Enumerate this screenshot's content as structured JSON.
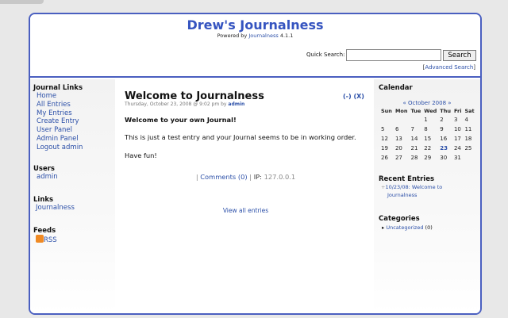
{
  "header": {
    "title": "Drew's Journalness",
    "powered_prefix": "Powered by",
    "powered_link": "Journalness",
    "version": "4.1.1",
    "search_label": "Quick Search:",
    "search_value": "",
    "search_button": "Search",
    "advanced_search": "Advanced Search"
  },
  "left": {
    "journal_links_title": "Journal Links",
    "journal_links": [
      "Home",
      "All Entries",
      "My Entries",
      "Create Entry",
      "User Panel",
      "Admin Panel",
      "Logout admin"
    ],
    "users_title": "Users",
    "users": [
      "admin"
    ],
    "links_title": "Links",
    "links": [
      "Journalness"
    ],
    "feeds_title": "Feeds",
    "feeds": [
      "RSS"
    ]
  },
  "entry": {
    "title": "Welcome to Journalness",
    "meta_prefix": "Thursday, October 23, 2008 @ 9:02 pm by",
    "author": "admin",
    "actions": [
      "(-)",
      "(X)"
    ],
    "heading": "Welcome to your own Journal!",
    "paragraph": "This is just a test entry and your Journal seems to be in working order.",
    "closing": "Have fun!",
    "comments": "Comments (0)",
    "ip_label": "IP:",
    "ip": "127.0.0.1",
    "view_all": "View all entries"
  },
  "right": {
    "calendar_title": "Calendar",
    "month": "October 2008",
    "prev": "«",
    "next": "»",
    "weekdays": [
      "Sun",
      "Mon",
      "Tue",
      "Wed",
      "Thu",
      "Fri",
      "Sat"
    ],
    "weeks": [
      [
        "",
        "",
        "",
        "1",
        "2",
        "3",
        "4"
      ],
      [
        "5",
        "6",
        "7",
        "8",
        "9",
        "10",
        "11"
      ],
      [
        "12",
        "13",
        "14",
        "15",
        "16",
        "17",
        "18"
      ],
      [
        "19",
        "20",
        "21",
        "22",
        "23",
        "24",
        "25"
      ],
      [
        "26",
        "27",
        "28",
        "29",
        "30",
        "31",
        ""
      ]
    ],
    "today": "23",
    "recent_title": "Recent Entries",
    "recent": [
      "10/23/08: Welcome to",
      "Journalness"
    ],
    "categories_title": "Categories",
    "category": "Uncategorized",
    "category_count": "(0)"
  }
}
